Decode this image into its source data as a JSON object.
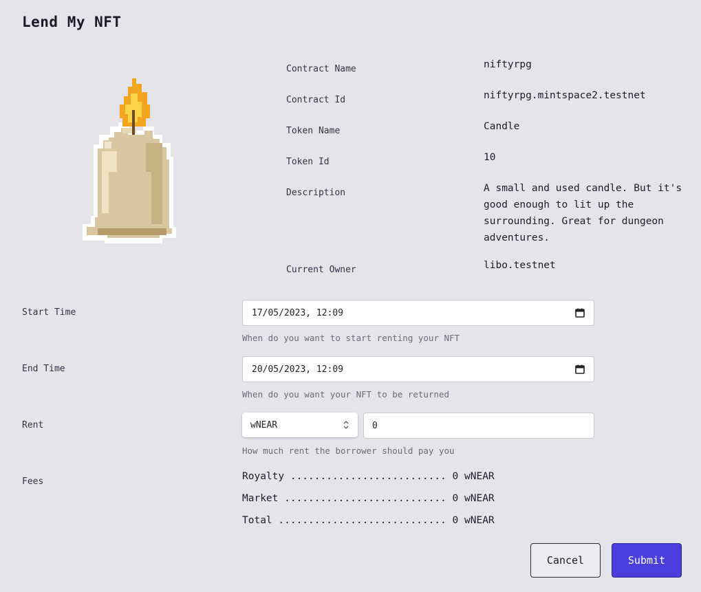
{
  "page": {
    "title": "Lend My NFT"
  },
  "nft": {
    "image_icon": "candle-image",
    "fields": [
      {
        "label": "Contract Name",
        "value": "niftyrpg"
      },
      {
        "label": "Contract Id",
        "value": "niftyrpg.mintspace2.testnet"
      },
      {
        "label": "Token Name",
        "value": "Candle"
      },
      {
        "label": "Token Id",
        "value": "10"
      },
      {
        "label": "Description",
        "value": "A small and used candle. But it's good enough to lit up the surrounding. Great for dungeon adventures."
      },
      {
        "label": "Current Owner",
        "value": "libo.testnet"
      }
    ]
  },
  "form": {
    "start_time": {
      "label": "Start Time",
      "value": "17/05/2023, 12:09",
      "help": "When do you want to start renting your NFT",
      "icon": "calendar-icon"
    },
    "end_time": {
      "label": "End Time",
      "value": "20/05/2023, 12:09",
      "help": "When do you want your NFT to be returned",
      "icon": "calendar-icon"
    },
    "rent": {
      "label": "Rent",
      "currency": "wNEAR",
      "amount": "0",
      "help": "How much rent the borrower should pay you",
      "icon": "select-arrows-icon"
    },
    "fees": {
      "label": "Fees",
      "lines": [
        "Royalty .......................... 0 wNEAR",
        "Market ........................... 0 wNEAR",
        "Total ............................ 0 wNEAR"
      ]
    }
  },
  "actions": {
    "cancel": "Cancel",
    "submit": "Submit"
  },
  "colors": {
    "background": "#e5e4e9",
    "primary": "#4a3fdc"
  }
}
